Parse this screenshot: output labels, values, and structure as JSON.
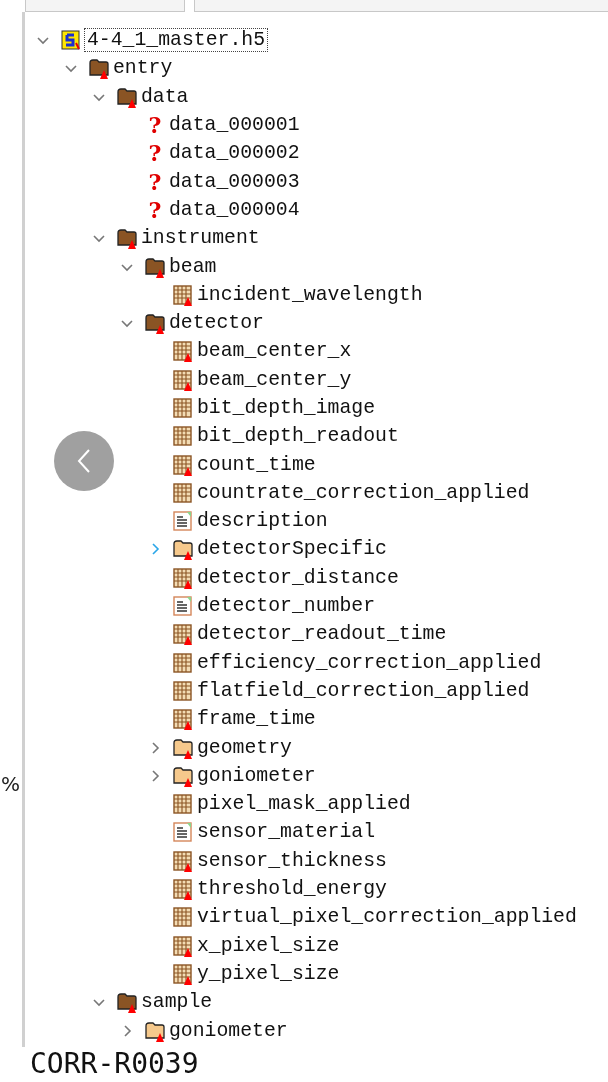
{
  "tree": [
    {
      "name": "4-4_1_master.h5",
      "kind": "file",
      "expanded": true,
      "children": [
        {
          "name": "entry",
          "kind": "group",
          "attr": true,
          "expanded": true,
          "children": [
            {
              "name": "data",
              "kind": "group",
              "attr": true,
              "expanded": true,
              "children": [
                {
                  "name": "data_000001",
                  "kind": "unknown",
                  "glyph": "?"
                },
                {
                  "name": "data_000002",
                  "kind": "unknown",
                  "glyph": "?"
                },
                {
                  "name": "data_000003",
                  "kind": "unknown",
                  "glyph": "?"
                },
                {
                  "name": "data_000004",
                  "kind": "unknown",
                  "glyph": "?"
                }
              ]
            },
            {
              "name": "instrument",
              "kind": "group",
              "attr": true,
              "expanded": true,
              "children": [
                {
                  "name": "beam",
                  "kind": "group",
                  "attr": true,
                  "expanded": true,
                  "children": [
                    {
                      "name": "incident_wavelength",
                      "kind": "dataset",
                      "attr": true
                    }
                  ]
                },
                {
                  "name": "detector",
                  "kind": "group",
                  "attr": true,
                  "expanded": true,
                  "children": [
                    {
                      "name": "beam_center_x",
                      "kind": "dataset",
                      "attr": true
                    },
                    {
                      "name": "beam_center_y",
                      "kind": "dataset",
                      "attr": true
                    },
                    {
                      "name": "bit_depth_image",
                      "kind": "dataset",
                      "attr": false
                    },
                    {
                      "name": "bit_depth_readout",
                      "kind": "dataset",
                      "attr": false
                    },
                    {
                      "name": "count_time",
                      "kind": "dataset",
                      "attr": true
                    },
                    {
                      "name": "countrate_correction_applied",
                      "kind": "dataset",
                      "attr": false
                    },
                    {
                      "name": "description",
                      "kind": "text",
                      "attr": false
                    },
                    {
                      "name": "detectorSpecific",
                      "kind": "group",
                      "attr": true,
                      "expanded": false,
                      "hovered": true
                    },
                    {
                      "name": "detector_distance",
                      "kind": "dataset",
                      "attr": true
                    },
                    {
                      "name": "detector_number",
                      "kind": "text",
                      "attr": false
                    },
                    {
                      "name": "detector_readout_time",
                      "kind": "dataset",
                      "attr": true
                    },
                    {
                      "name": "efficiency_correction_applied",
                      "kind": "dataset",
                      "attr": false
                    },
                    {
                      "name": "flatfield_correction_applied",
                      "kind": "dataset",
                      "attr": false
                    },
                    {
                      "name": "frame_time",
                      "kind": "dataset",
                      "attr": true
                    },
                    {
                      "name": "geometry",
                      "kind": "group",
                      "attr": true,
                      "expanded": false,
                      "hovered": false
                    },
                    {
                      "name": "goniometer",
                      "kind": "group",
                      "attr": true,
                      "expanded": false,
                      "hovered": false
                    },
                    {
                      "name": "pixel_mask_applied",
                      "kind": "dataset",
                      "attr": false
                    },
                    {
                      "name": "sensor_material",
                      "kind": "text",
                      "attr": false
                    },
                    {
                      "name": "sensor_thickness",
                      "kind": "dataset",
                      "attr": true
                    },
                    {
                      "name": "threshold_energy",
                      "kind": "dataset",
                      "attr": true
                    },
                    {
                      "name": "virtual_pixel_correction_applied",
                      "kind": "dataset",
                      "attr": false
                    },
                    {
                      "name": "x_pixel_size",
                      "kind": "dataset",
                      "attr": true
                    },
                    {
                      "name": "y_pixel_size",
                      "kind": "dataset",
                      "attr": true
                    }
                  ]
                }
              ]
            },
            {
              "name": "sample",
              "kind": "group",
              "attr": true,
              "expanded": true,
              "children": [
                {
                  "name": "goniometer",
                  "kind": "group",
                  "attr": true,
                  "expanded": false,
                  "hovered": false
                }
              ]
            }
          ]
        }
      ]
    }
  ],
  "left_edge_text": "%",
  "footer_text": "CORR-R0039"
}
